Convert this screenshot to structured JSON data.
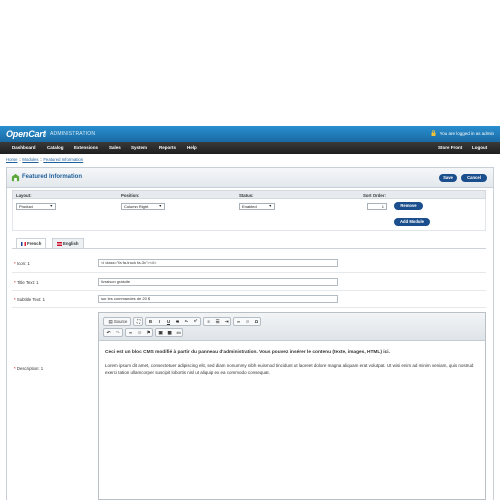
{
  "header": {
    "logo": "OpenCart",
    "separator": "|",
    "admin": "ADMINISTRATION",
    "logged_in": "You are logged in as admin"
  },
  "menu": [
    "Dashboard",
    "Catalog",
    "Extensions",
    "Sales",
    "System",
    "Reports",
    "Help"
  ],
  "menu_right": [
    "Store Front",
    "Logout"
  ],
  "breadcrumb": [
    "Home",
    "Modules",
    "Featured Information"
  ],
  "breadcrumb_sep": "::",
  "panel": {
    "title": "Featured Information",
    "save": "Save",
    "cancel": "Cancel"
  },
  "module_table": {
    "headers": [
      "Layout:",
      "Position:",
      "Status:",
      "Sort Order:"
    ],
    "layout": "Product",
    "position": "Column Right",
    "status": "Enabled",
    "sort_order": "1",
    "remove": "Remove",
    "add": "Add Module"
  },
  "tabs": [
    "French",
    "English"
  ],
  "fields": {
    "icon_label": "Icon: 1",
    "icon_value": "<i class=\"fa fa-truck fa-3x\"></i>",
    "title_label": "Title Text: 1",
    "title_value": "livraison gratuite",
    "subtitle_label": "Subtitle Text: 1",
    "subtitle_value": "sur les commandes de 20 $",
    "description_label": "Description: 1",
    "required": "*"
  },
  "editor": {
    "source": "Source",
    "heading": "Ceci est un bloc CMS modifié à partir du panneau d'administration. Vous pouvez insérer le contenu (texte, images, HTML) ici.",
    "paragraph": "Lorem ipsum dit amet, consectetuer adipiscing elit, sed diam nonummy nibh euismod tincidunt ut laoreet dolore magna aliquam erat volutpat. Ut wisi enim ad minim veniam, quis nostrud exerci tation ullamcorper suscipit lobortis nisl ut aliquip ex ea commodo consequat."
  },
  "colors": {
    "header_blue": "#1f7ab6",
    "menu_dark": "#2b2b2b",
    "button_navy": "#1b4e8c",
    "title_blue": "#1f5f9a"
  }
}
